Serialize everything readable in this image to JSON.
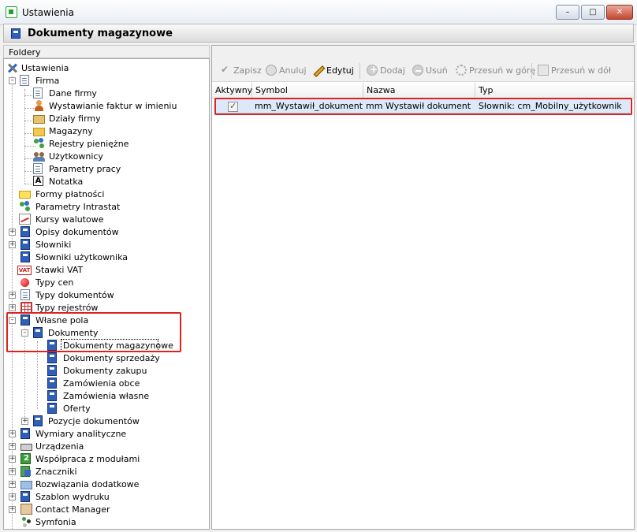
{
  "window": {
    "title": "Ustawienia"
  },
  "header": {
    "title": "Dokumenty magazynowe"
  },
  "left_panel": {
    "header": "Foldery"
  },
  "tree": {
    "root": "Ustawienia",
    "firma": "Firma",
    "dane_firmy": "Dane firmy",
    "wystawianie": "Wystawianie faktur w imieniu",
    "dzialy": "Działy firmy",
    "magazyny": "Magazyny",
    "rejestry": "Rejestry pieniężne",
    "uzytkownicy": "Użytkownicy",
    "parametry_pracy": "Parametry pracy",
    "notatka": "Notatka",
    "formy": "Formy płatności",
    "intrastat": "Parametry Intrastat",
    "kursy": "Kursy walutowe",
    "opisy": "Opisy dokumentów",
    "slowniki": "Słowniki",
    "slowniki_uz": "Słowniki użytkownika",
    "stawki": "Stawki VAT",
    "typy_cen": "Typy cen",
    "typy_dok": "Typy dokumentów",
    "typy_rej": "Typy rejestrów",
    "wlasne": "Własne pola",
    "dokumenty": "Dokumenty",
    "dok_mag": "Dokumenty magazynowe",
    "dok_sprz": "Dokumenty sprzedaży",
    "dok_zak": "Dokumenty zakupu",
    "zam_obce": "Zamówienia obce",
    "zam_wlasne": "Zamówienia własne",
    "oferty": "Oferty",
    "pozycje": "Pozycje dokumentów",
    "wymiary": "Wymiary analityczne",
    "urzadzenia": "Urządzenia",
    "wspolpraca": "Współpraca z modułami",
    "znaczniki": "Znaczniki",
    "rozwiazania": "Rozwiązania dodatkowe",
    "szablon": "Szablon wydruku",
    "contact": "Contact Manager",
    "symfonia": "Symfonia",
    "vat_badge": "VAT"
  },
  "toolbar": {
    "zapisz": "Zapisz",
    "anuluj": "Anuluj",
    "edytuj": "Edytuj",
    "dodaj": "Dodaj",
    "usun": "Usuń",
    "up": "Przesuń w górę",
    "down": "Przesuń w dół"
  },
  "grid": {
    "columns": [
      "Aktywny",
      "Symbol",
      "Nazwa",
      "Typ"
    ],
    "rows": [
      {
        "aktywny": true,
        "symbol": "mm_Wystawił_dokument",
        "nazwa": "mm Wystawił dokument",
        "typ": "Słownik: cm_Mobilny_użytkownik"
      }
    ]
  }
}
